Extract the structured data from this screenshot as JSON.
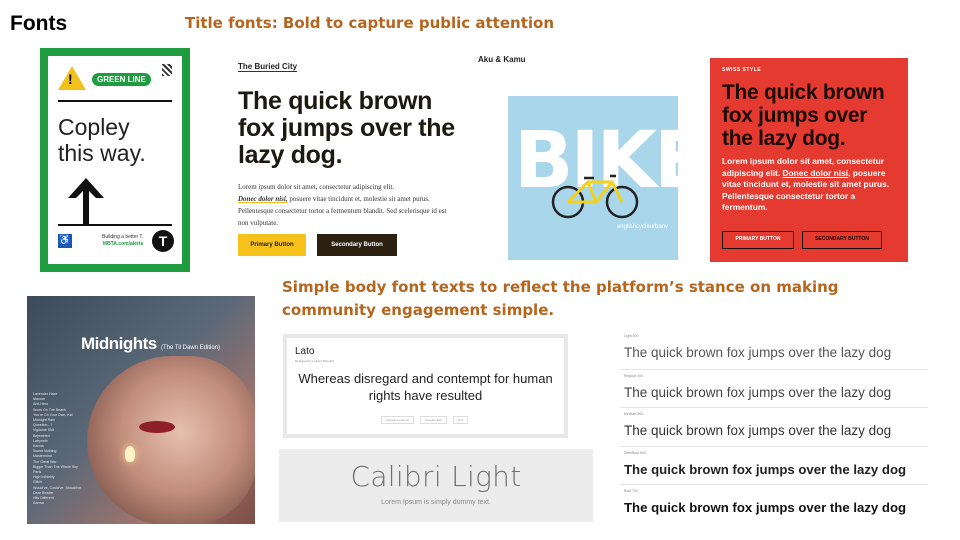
{
  "slide": {
    "title": "Fonts",
    "title_fonts_heading": "Title fonts: Bold to capture public attention",
    "body_fonts_heading": "Simple body font texts to reflect the platform’s stance on making community engagement simple.",
    "heading_color": "#b5651d"
  },
  "copley_sign": {
    "badge": "GREEN LINE",
    "headline_line1": "Copley",
    "headline_line2": "this way.",
    "footer_line1": "Building a better T.",
    "footer_link": "MBTA.com/alerts",
    "logo_letter": "T",
    "frame_color": "#1e9c3f",
    "icons": [
      "warning-icon",
      "qr-code-icon",
      "up-arrow-icon",
      "wheelchair-icon",
      "mbta-t-logo"
    ]
  },
  "buried_city": {
    "label": "The Buried City",
    "headline": "The quick brown fox jumps over the lazy dog.",
    "body_before": "Lorem ipsum dolor sit amet, consectetur adipiscing elit.",
    "body_highlight": "Donec dolor nisi,",
    "body_after": "posuere vitae tincidunt et, molestie sit amet purus. Pellentesque consectetur tortor a fermentum blandit. Sed scelerisque id est non vulputate.",
    "primary_button": "Primary Button",
    "secondary_button": "Secondary Button",
    "accent_color": "#f7c31a"
  },
  "bike_poster": {
    "title": "Aku & Kamu",
    "word": "BIKE",
    "tagline": "englishcycleurbanv",
    "background_color": "#a9d6ea"
  },
  "swiss_style": {
    "label": "SWISS STYLE",
    "headline": "The quick brown fox jumps over the lazy dog.",
    "body_before": "Lorem ipsum dolor sit amet, consectetur adipiscing elit.",
    "body_link": "Donec dolor nisi,",
    "body_after": "posuere vitae tincidunt et, molestie sit amet purus. Pellentesque consectetur tortor a fermentum.",
    "primary_button": "PRIMARY BUTTON",
    "secondary_button": "SECONDARY BUTTON",
    "background_color": "#e43a2f"
  },
  "midnights": {
    "title": "Midnights",
    "edition": "(The Til Dawn Edition)",
    "tracklist": [
      "Lavender Haze",
      "Maroon",
      "Anti-Hero",
      "Snow On The Beach",
      "You're On Your Own, Kid",
      "Midnight Rain",
      "Question...?",
      "Vigilante Shit",
      "Bejeweled",
      "Labyrinth",
      "Karma",
      "Sweet Nothing",
      "Mastermind",
      "The Great War",
      "Bigger Than The Whole Sky",
      "Paris",
      "High Infidelity",
      "Glitch",
      "Would've, Could've, Should've",
      "Dear Reader",
      "Hits Different",
      "Karma"
    ]
  },
  "lato_card": {
    "name": "Lato",
    "sub": "Designed by Łukasz Dziedzic",
    "sample": "Whereas disregard and contempt for human rights have resulted",
    "control_1": "Sample sentence",
    "control_2": "Regular 400",
    "control_3": "Size"
  },
  "calibri_card": {
    "name": "Calibri Light",
    "sub": "Lorem Ipsum is simply dummy text."
  },
  "weights_list": {
    "rows": [
      {
        "label": "Light 300",
        "sample": "The quick brown fox jumps over the lazy dog"
      },
      {
        "label": "Regular 400",
        "sample": "The quick brown fox jumps over the lazy dog"
      },
      {
        "label": "Medium 500",
        "sample": "The quick brown fox jumps over the lazy dog"
      },
      {
        "label": "SemiBold 600",
        "sample": "The quick brown fox jumps over the lazy dog"
      },
      {
        "label": "Bold 700",
        "sample": "The quick brown fox jumps over the lazy dog"
      }
    ]
  }
}
